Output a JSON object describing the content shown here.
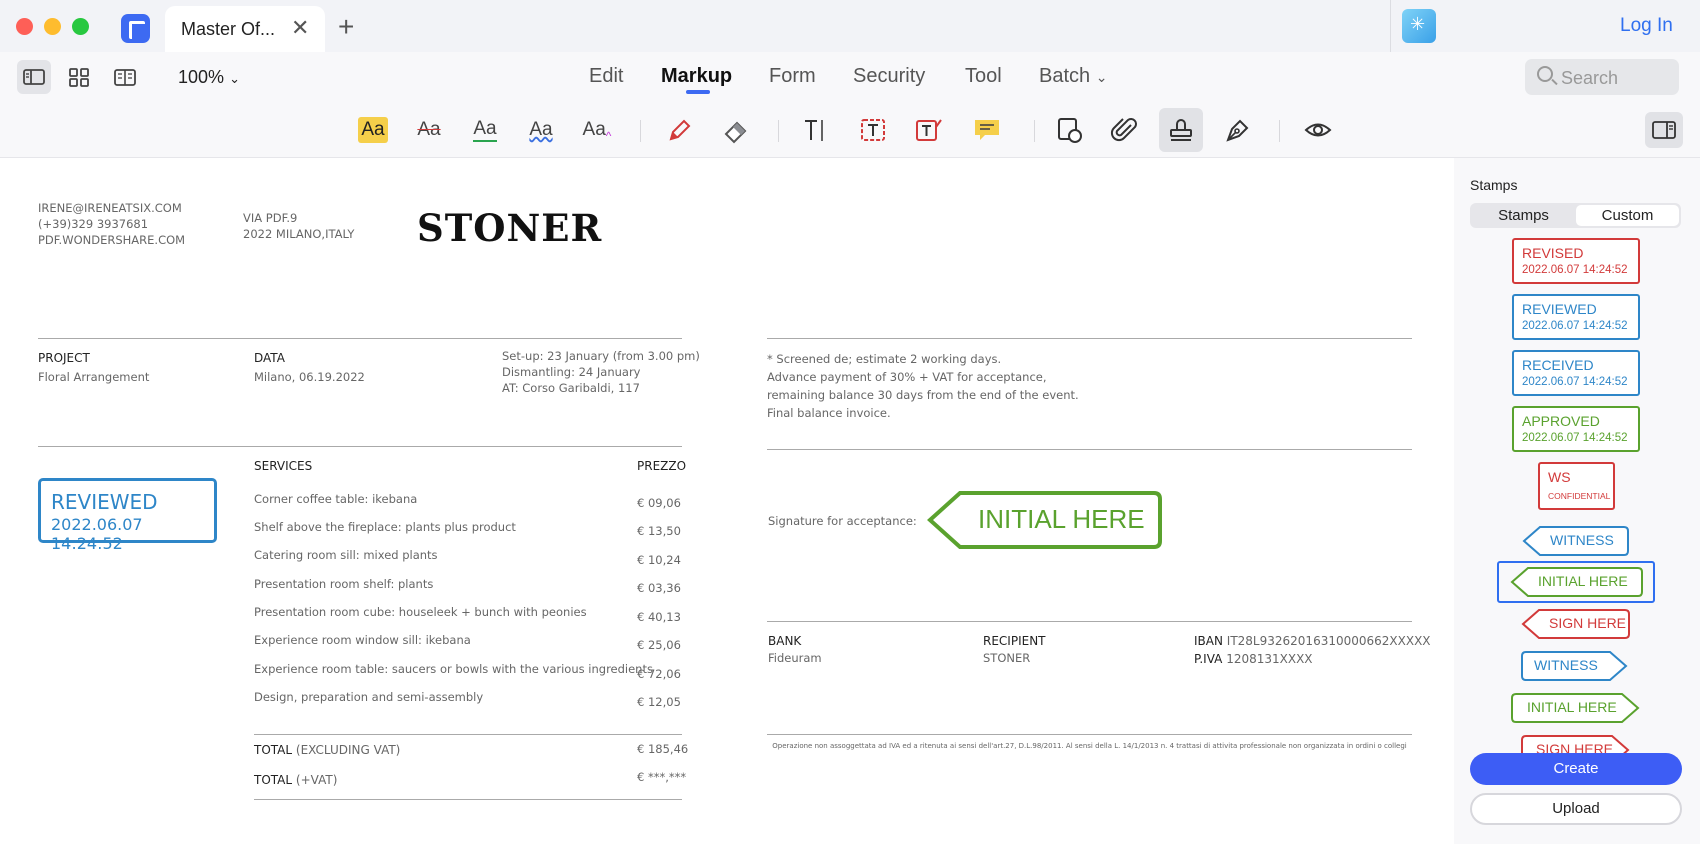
{
  "window": {
    "tab_title": "Master Of...",
    "login_label": "Log In"
  },
  "toolbar": {
    "zoom": "100%",
    "menus": [
      "Edit",
      "Markup",
      "Form",
      "Security",
      "Tool",
      "Batch"
    ],
    "active_menu": "Markup",
    "search_placeholder": "Search"
  },
  "markup_tools": {
    "text_tool_labels": [
      "Aa",
      "Aa",
      "Aa",
      "Aa",
      "Aa"
    ],
    "active_tool": "stamp-tool",
    "colors": {
      "highlight": "#f5cf4a",
      "strikethrough": "#d23a3a",
      "underline": "#2aa44f",
      "squiggly": "#3a6fe0",
      "caret": "#c23ad8",
      "accent": "#3d6af2"
    }
  },
  "document": {
    "contact": [
      "IRENE@IRENEATSIX.COM",
      "(+39)329 3937681",
      "PDF.WONDERSHARE.COM"
    ],
    "address": [
      "VIA PDF.9",
      "2022 MILANO,ITALY"
    ],
    "brand": "STONER",
    "project_label": "PROJECT",
    "project_value": "Floral Arrangement",
    "data_label": "DATA",
    "data_value": "Milano, 06.19.2022",
    "schedule": [
      "Set-up: 23 January (from 3.00 pm)",
      "Dismantling: 24 January",
      "AT: Corso Garibaldi, 117"
    ],
    "notes": [
      "* Screened de; estimate 2 working days.",
      "Advance payment of 30% + VAT for acceptance,",
      "remaining balance 30 days from the end of the event.",
      "Final balance invoice."
    ],
    "services_label": "SERVICES",
    "price_label": "PREZZO",
    "services": [
      {
        "name": "Corner coffee table: ikebana",
        "price": "€ 09,06"
      },
      {
        "name": "Shelf above the fireplace: plants plus product",
        "price": "€ 13,50"
      },
      {
        "name": "Catering room sill: mixed plants",
        "price": "€ 10,24"
      },
      {
        "name": "Presentation room shelf: plants",
        "price": "€ 03,36"
      },
      {
        "name": "Presentation room cube: houseleek + bunch with peonies",
        "price": "€ 40,13"
      },
      {
        "name": "Experience room window sill: ikebana",
        "price": "€ 25,06"
      },
      {
        "name": "Experience room table: saucers or bowls with the various ingredients",
        "price": "€ 72,06"
      },
      {
        "name": "Design, preparation and semi-assembly",
        "price": "€ 12,05"
      }
    ],
    "total_label": "TOTAL",
    "total_excl": "(EXCLUDING VAT)",
    "total_excl_value": "€ 185,46",
    "total_vat": "(+VAT)",
    "total_vat_value": "€ ***,***",
    "signature_label": "Signature for acceptance:",
    "initial_stamp": "INITIAL HERE",
    "reviewed_stamp": {
      "title": "REVIEWED",
      "date": "2022.06.07 14:24:52"
    },
    "bank_label": "BANK",
    "bank_value": "Fideuram",
    "recipient_label": "RECIPIENT",
    "recipient_value": "STONER",
    "iban_label": "IBAN",
    "iban_value": "IT28L93262016310000662XXXXX",
    "piva_label": "P.IVA",
    "piva_value": "1208131XXXX",
    "footer_note": "Operazione non assoggettata ad IVA ed a ritenuta ai sensi dell'art.27, D.L.98/2011. Al sensi della L. 14/1/2013 n. 4 trattasi di attivita professionale non organizzata in ordini o collegi"
  },
  "sidebar": {
    "title": "Stamps",
    "tabs": [
      "Stamps",
      "Custom"
    ],
    "active_tab": "Custom",
    "rect_stamps": [
      {
        "title": "REVISED",
        "subtitle": "2022.06.07 14:24:52",
        "color": "#d23a3a"
      },
      {
        "title": "REVIEWED",
        "subtitle": "2022.06.07 14:24:52",
        "color": "#2e86c8"
      },
      {
        "title": "RECEIVED",
        "subtitle": "2022.06.07 14:24:52",
        "color": "#2e86c8"
      },
      {
        "title": "APPROVED",
        "subtitle": "2022.06.07 14:24:52",
        "color": "#5aa22e"
      },
      {
        "title": "WS",
        "subtitle": "CONFIDENTIAL",
        "color": "#d23a3a"
      }
    ],
    "arrow_stamps": [
      {
        "label": "WITNESS",
        "color": "#2e86c8"
      },
      {
        "label": "INITIAL HERE",
        "color": "#5aa22e"
      },
      {
        "label": "SIGN HERE",
        "color": "#d23a3a"
      },
      {
        "label": "WITNESS",
        "color": "#2e86c8"
      },
      {
        "label": "INITIAL HERE",
        "color": "#5aa22e"
      },
      {
        "label": "SIGN HERE",
        "color": "#d23a3a"
      }
    ],
    "create_label": "Create",
    "upload_label": "Upload"
  }
}
